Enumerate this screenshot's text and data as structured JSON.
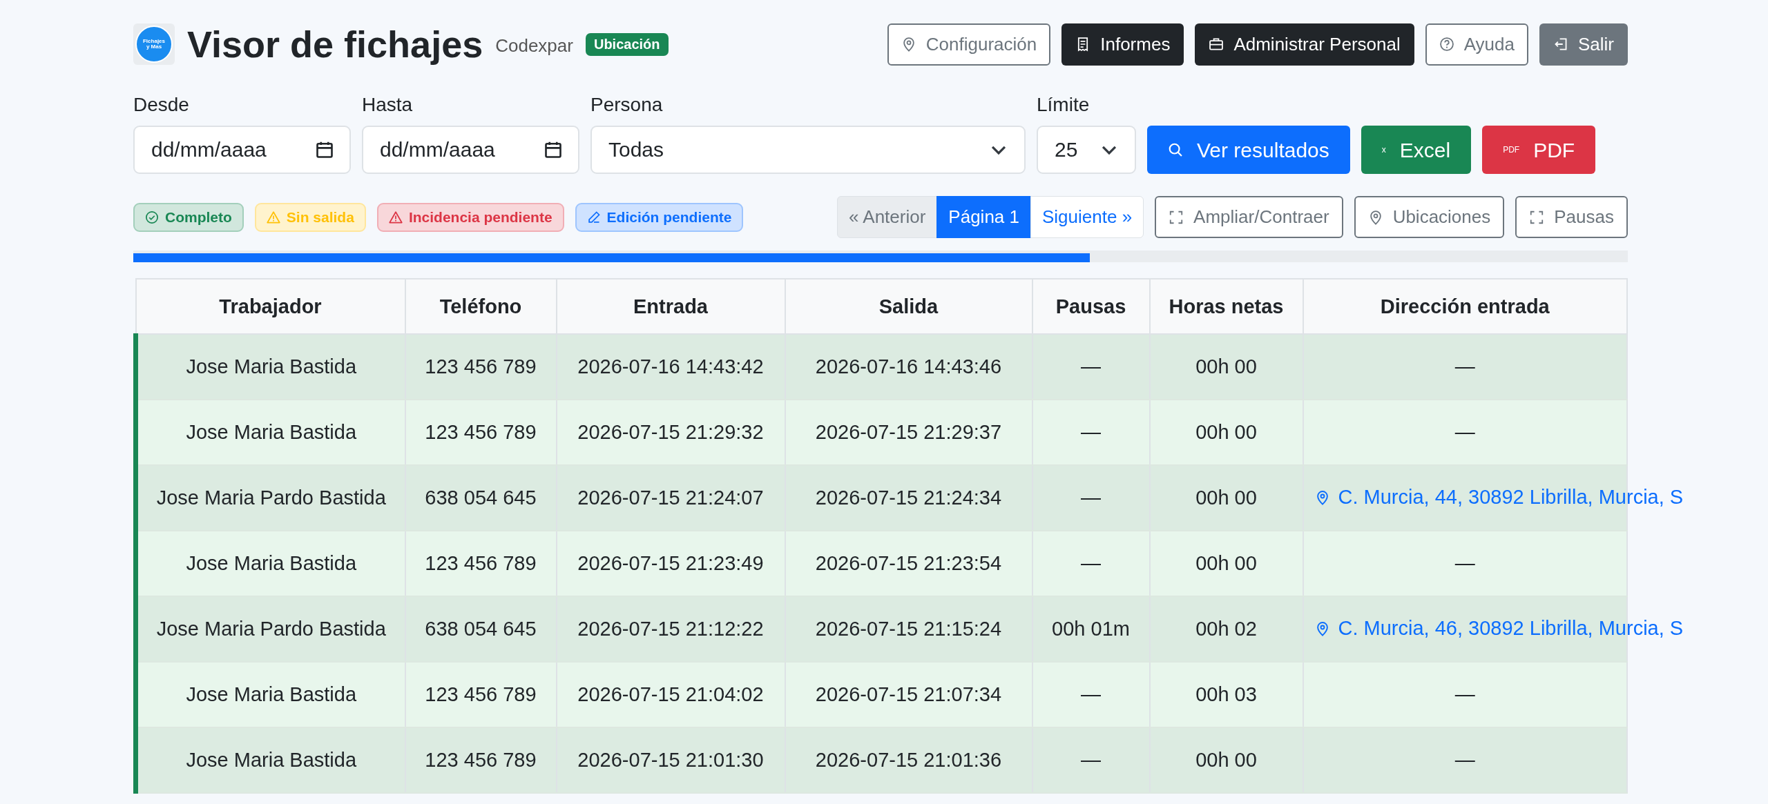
{
  "header": {
    "logo_text": "Fichajes y Mas",
    "title": "Visor de fichajes",
    "company": "Codexpar",
    "badge": "Ubicación",
    "nav_buttons": [
      {
        "label": "Configuración",
        "kind": "outline"
      },
      {
        "label": "Informes",
        "kind": "dark"
      },
      {
        "label": "Administrar Personal",
        "kind": "dark"
      },
      {
        "label": "Ayuda",
        "kind": "outline"
      },
      {
        "label": "Salir",
        "kind": "secondary"
      }
    ]
  },
  "filters": {
    "desde": {
      "label": "Desde",
      "placeholder": "dd/mm/aaaa"
    },
    "hasta": {
      "label": "Hasta",
      "placeholder": "dd/mm/aaaa"
    },
    "persona": {
      "label": "Persona",
      "value": "Todas"
    },
    "limite": {
      "label": "Límite",
      "value": "25"
    },
    "actions": [
      {
        "label": "Ver resultados",
        "kind": "primary"
      },
      {
        "label": "Excel",
        "kind": "success",
        "icon_text": "x"
      },
      {
        "label": "PDF",
        "kind": "danger",
        "icon_text": "PDF"
      }
    ]
  },
  "legend": [
    {
      "label": "Completo",
      "kind": "complete"
    },
    {
      "label": "Sin salida",
      "kind": "warning"
    },
    {
      "label": "Incidencia pendiente",
      "kind": "danger"
    },
    {
      "label": "Edición pendiente",
      "kind": "info"
    }
  ],
  "pagination": [
    {
      "label": "« Anterior",
      "selected": false,
      "disabled": true
    },
    {
      "label": "Página 1",
      "selected": true,
      "disabled": false
    },
    {
      "label": "Siguiente »",
      "selected": false,
      "disabled": false
    }
  ],
  "tools": [
    {
      "label": "Ampliar/Contraer"
    },
    {
      "label": "Ubicaciones"
    },
    {
      "label": "Pausas"
    }
  ],
  "progress": {
    "level": 0.64
  },
  "table": {
    "columns": [
      "Trabajador",
      "Teléfono",
      "Entrada",
      "Salida",
      "Pausas",
      "Horas netas",
      "Dirección entrada"
    ],
    "rows": [
      {
        "kind": "complete",
        "cells": [
          "Jose Maria Bastida",
          "123 456 789",
          "2026-07-16 14:43:42",
          "2026-07-16 14:43:46",
          "—",
          "00h 00"
        ],
        "address": {
          "text": "—",
          "located": false
        }
      },
      {
        "kind": "complete",
        "cells": [
          "Jose Maria Bastida",
          "123 456 789",
          "2026-07-15 21:29:32",
          "2026-07-15 21:29:37",
          "—",
          "00h 00"
        ],
        "address": {
          "text": "—",
          "located": false
        }
      },
      {
        "kind": "complete",
        "cells": [
          "Jose Maria Pardo Bastida",
          "638 054 645",
          "2026-07-15 21:24:07",
          "2026-07-15 21:24:34",
          "—",
          "00h 00"
        ],
        "address": {
          "text": "C. Murcia, 44, 30892 Librilla, Murcia, S",
          "located": true
        }
      },
      {
        "kind": "complete",
        "cells": [
          "Jose Maria Bastida",
          "123 456 789",
          "2026-07-15 21:23:49",
          "2026-07-15 21:23:54",
          "—",
          "00h 00"
        ],
        "address": {
          "text": "—",
          "located": false
        }
      },
      {
        "kind": "complete",
        "cells": [
          "Jose Maria Pardo Bastida",
          "638 054 645",
          "2026-07-15 21:12:22",
          "2026-07-15 21:15:24",
          "00h 01m",
          "00h 02"
        ],
        "address": {
          "text": "C. Murcia, 46, 30892 Librilla, Murcia, S",
          "located": true
        }
      },
      {
        "kind": "complete",
        "cells": [
          "Jose Maria Bastida",
          "123 456 789",
          "2026-07-15 21:04:02",
          "2026-07-15 21:07:34",
          "—",
          "00h 03"
        ],
        "address": {
          "text": "—",
          "located": false
        }
      },
      {
        "kind": "complete",
        "cells": [
          "Jose Maria Bastida",
          "123 456 789",
          "2026-07-15 21:01:30",
          "2026-07-15 21:01:36",
          "—",
          "00h 00"
        ],
        "address": {
          "text": "—",
          "located": false
        }
      }
    ]
  }
}
